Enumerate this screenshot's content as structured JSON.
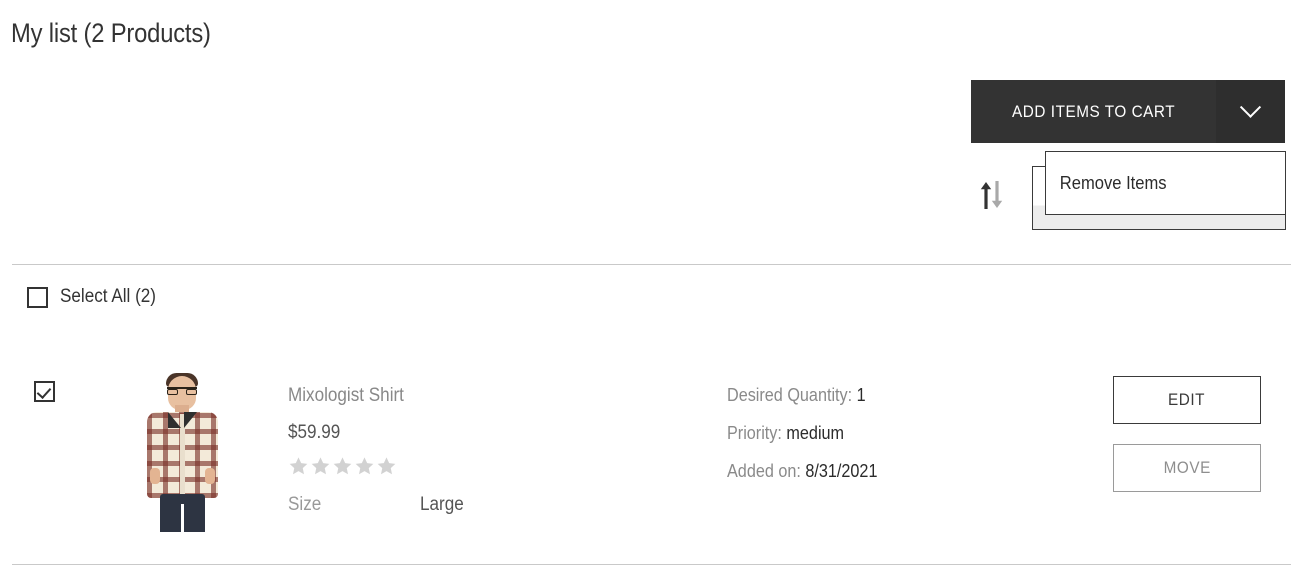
{
  "header": {
    "title": "My list (2 Products)"
  },
  "toolbar": {
    "add_to_cart_label": "ADD ITEMS TO CART",
    "dropdown_toggle_icon": "chevron-down-icon",
    "sort_icon": "sort-arrows-icon",
    "dropdown": {
      "open": true,
      "items": [
        {
          "label": "Remove Items"
        }
      ]
    }
  },
  "list": {
    "select_all_label": "Select All (2)",
    "select_all_checked": false,
    "products": [
      {
        "selected": true,
        "name": "Mixologist Shirt",
        "price": "$59.99",
        "rating": 0,
        "rating_max": 5,
        "spec_key": "Size",
        "spec_value": "Large",
        "quantity_label": "Desired Quantity:",
        "quantity_value": "1",
        "priority_label": "Priority:",
        "priority_value": "medium",
        "added_label": "Added on:",
        "added_value": "8/31/2021",
        "edit_label": "EDIT",
        "move_label": "MOVE",
        "image_alt": "man wearing plaid mixologist shirt"
      }
    ]
  },
  "colors": {
    "button_dark": "#333333",
    "button_dark_toggle": "#2e2e2e",
    "text_dark": "#333333",
    "text_muted": "#8a8a8a",
    "star_empty": "#d2d2d2",
    "divider": "#c9c9c9"
  }
}
